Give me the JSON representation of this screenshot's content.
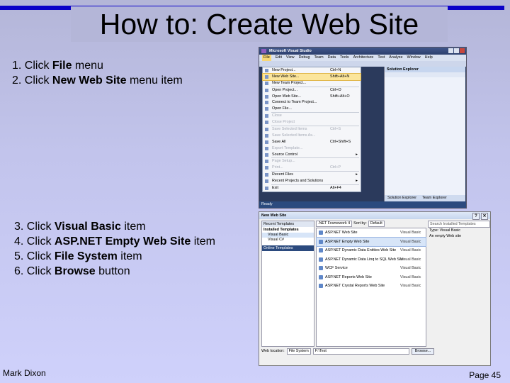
{
  "title": "How to: Create Web Site",
  "steps_a": [
    {
      "prefix": "1. Click ",
      "bold": "File",
      "suffix": " menu"
    },
    {
      "prefix": "2. Click ",
      "bold": "New Web Site",
      "suffix": " menu item"
    }
  ],
  "steps_b": [
    {
      "prefix": "3. Click ",
      "bold": "Visual Basic",
      "suffix": " item"
    },
    {
      "prefix": "4. Click ",
      "bold": "ASP.NET Empty Web Site",
      "suffix": " item"
    },
    {
      "prefix": "5. Click ",
      "bold": "File System",
      "suffix": " item"
    },
    {
      "prefix": "6. Click ",
      "bold": "Browse",
      "suffix": " button"
    }
  ],
  "footer": {
    "author": "Mark Dixon",
    "page": "Page 45"
  },
  "vs1": {
    "window_title": "Microsoft Visual Studio",
    "menubar": [
      "File",
      "Edit",
      "View",
      "Debug",
      "Team",
      "Data",
      "Tools",
      "Architecture",
      "Test",
      "Analyze",
      "Window",
      "Help"
    ],
    "file_menu": [
      {
        "label": "New Project...",
        "shortcut": "Ctrl+N",
        "state": "normal"
      },
      {
        "label": "New Web Site...",
        "shortcut": "Shift+Alt+N",
        "state": "highlight"
      },
      {
        "label": "New Team Project...",
        "shortcut": "",
        "state": "normal"
      },
      {
        "sep": true
      },
      {
        "label": "Open Project...",
        "shortcut": "Ctrl+O",
        "state": "normal"
      },
      {
        "label": "Open Web Site...",
        "shortcut": "Shift+Alt+O",
        "state": "normal"
      },
      {
        "label": "Connect to Team Project...",
        "shortcut": "",
        "state": "normal"
      },
      {
        "label": "Open File...",
        "shortcut": "",
        "state": "normal"
      },
      {
        "sep": true
      },
      {
        "label": "Close",
        "shortcut": "",
        "state": "disabled"
      },
      {
        "label": "Close Project",
        "shortcut": "",
        "state": "disabled"
      },
      {
        "sep": true
      },
      {
        "label": "Save Selected Items",
        "shortcut": "Ctrl+S",
        "state": "disabled"
      },
      {
        "label": "Save Selected Items As...",
        "shortcut": "",
        "state": "disabled"
      },
      {
        "label": "Save All",
        "shortcut": "Ctrl+Shift+S",
        "state": "normal"
      },
      {
        "label": "Export Template...",
        "shortcut": "",
        "state": "disabled"
      },
      {
        "label": "Source Control",
        "shortcut": "",
        "state": "normal",
        "submenu": true
      },
      {
        "sep": true
      },
      {
        "label": "Page Setup...",
        "shortcut": "",
        "state": "disabled"
      },
      {
        "label": "Print...",
        "shortcut": "Ctrl+P",
        "state": "disabled"
      },
      {
        "sep": true
      },
      {
        "label": "Recent Files",
        "shortcut": "",
        "state": "normal",
        "submenu": true
      },
      {
        "label": "Recent Projects and Solutions",
        "shortcut": "",
        "state": "normal",
        "submenu": true
      },
      {
        "sep": true
      },
      {
        "label": "Exit",
        "shortcut": "Alt+F4",
        "state": "normal"
      }
    ],
    "solution_explorer": "Solution Explorer",
    "bottom_tabs": [
      "Solution Explorer",
      "Team Explorer"
    ],
    "status": "Ready"
  },
  "vs2": {
    "window_title": "New Web Site",
    "left_header": "Recent Templates",
    "left_section": "Installed Templates",
    "left_items": [
      "Visual Basic",
      "Visual C#"
    ],
    "online": "Online Templates",
    "framework": ".NET Framework 4",
    "sort_by_label": "Sort by:",
    "sort_by_value": "Default",
    "search_placeholder": "Search Installed Templates",
    "templates": [
      {
        "name": "ASP.NET Web Site",
        "lang": "Visual Basic",
        "selected": false
      },
      {
        "name": "ASP.NET Empty Web Site",
        "lang": "Visual Basic",
        "selected": true
      },
      {
        "name": "ASP.NET Dynamic Data Entities Web Site",
        "lang": "Visual Basic",
        "selected": false
      },
      {
        "name": "ASP.NET Dynamic Data Linq to SQL Web Site",
        "lang": "Visual Basic",
        "selected": false
      },
      {
        "name": "WCF Service",
        "lang": "Visual Basic",
        "selected": false
      },
      {
        "name": "ASP.NET Reports Web Site",
        "lang": "Visual Basic",
        "selected": false
      },
      {
        "name": "ASP.NET Crystal Reports Web Site",
        "lang": "Visual Basic",
        "selected": false
      }
    ],
    "info_type": "Type: Visual Basic",
    "info_desc": "An empty Web site",
    "web_location_label": "Web location:",
    "web_location_value": "File System",
    "path_value": "F:\\Test",
    "browse_label": "Browse..."
  }
}
